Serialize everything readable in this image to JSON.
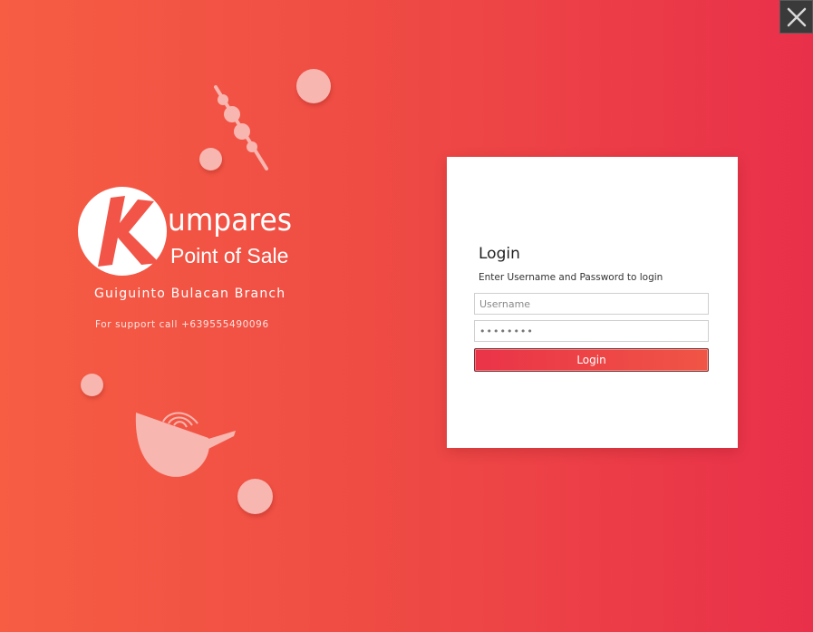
{
  "window": {
    "close_icon": "close-icon",
    "background_colors": [
      "#f65d43",
      "#e9304a"
    ]
  },
  "brand": {
    "logo_letter": "K",
    "name": "umpares",
    "subtitle": "Point of Sale",
    "branch": "Guiguinto Bulacan Branch",
    "support": "For support call +639555490096"
  },
  "login": {
    "title": "Login",
    "instructions": "Enter Username and Password to login",
    "username_placeholder": "Username",
    "username_value": "",
    "password_value": "Secret01",
    "button_label": "Login",
    "accent_color": "#ea3348"
  },
  "decor": {
    "icons": [
      "skewer-icon",
      "bowl-icon"
    ],
    "dot_color": "#f8b6b0"
  }
}
